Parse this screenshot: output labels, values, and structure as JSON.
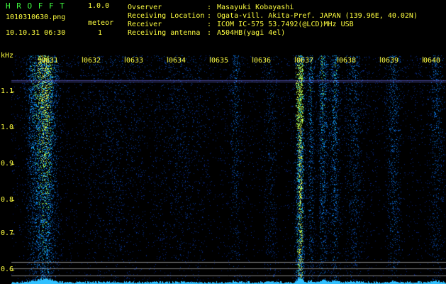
{
  "app": {
    "title": "H R O F F T",
    "version": "1.0.0",
    "file_name": "1010310630.png",
    "datetime": "10.10.31 06:30",
    "meteor_label": "meteor",
    "meteor_count": "1"
  },
  "info": {
    "rows": [
      {
        "label": "Ovserver",
        "sep": ":",
        "value": "Masayuki Kobayashi"
      },
      {
        "label": "Receiving Location",
        "sep": ":",
        "value": "Ogata-vill. Akita-Pref. JAPAN (139.96E, 40.02N)"
      },
      {
        "label": "Receiver",
        "sep": ":",
        "value": "ICOM IC-575 53.7492(@LCD)MHz USB"
      },
      {
        "label": "Receiving antenna",
        "sep": ":",
        "value": "A504HB(yagi 4el)"
      }
    ]
  },
  "axis": {
    "unit": "kHz",
    "freq_ticks": [
      "1.1",
      "1.0",
      "0.9",
      "0.8",
      "0.7",
      "0.6"
    ],
    "time_ticks": [
      "0631",
      "0632",
      "0633",
      "0634",
      "0635",
      "0636",
      "0637",
      "0638",
      "0639",
      "0640"
    ]
  },
  "colors": {
    "background": "#000000",
    "header_text": "#ffffff",
    "axis_text": "#ffff40",
    "accent": "#40ff40",
    "signal_low": "#1030a0",
    "signal_mid": "#30a0ff",
    "signal_high": "#c0ff40"
  }
}
